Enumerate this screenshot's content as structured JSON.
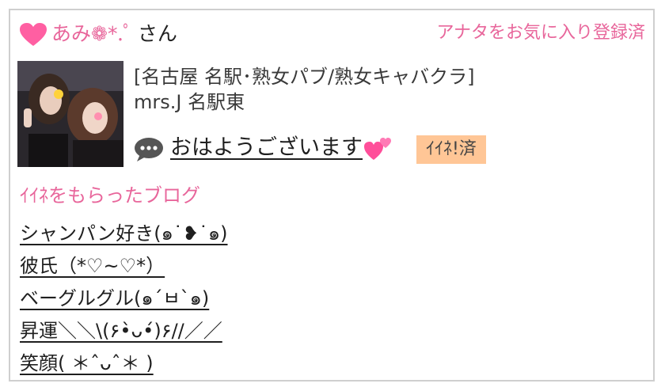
{
  "user": {
    "name": "あみ❁*.ﾟ",
    "honorific": "さん",
    "favorite_status": "アナタをお気に入り登録済"
  },
  "shop": {
    "category": "[名古屋 名駅･熟女パブ/熟女キャバクラ]",
    "name": "mrs.J 名駅東"
  },
  "message": {
    "text": "おはようございます",
    "like_badge": "ｲｲﾈ!済"
  },
  "blog": {
    "section_title": "ｲｲﾈをもらったブログ",
    "posts": [
      "シャンパン好き(๑˙❥˙๑)",
      "彼氏（*♡~♡*）",
      "ベーグルグル(๑´ㅂ`๑)",
      "昇運＼＼\\(۶•̀ᴗ•́)۶//／／",
      "笑顔( ＊ˆᴗˆ＊ )"
    ]
  },
  "colors": {
    "accent_pink": "#e8669b",
    "badge_bg": "#ffc696",
    "border": "#cfcfcf"
  },
  "icons": [
    "heart-icon",
    "speech-bubble-icon",
    "two-hearts-icon"
  ]
}
